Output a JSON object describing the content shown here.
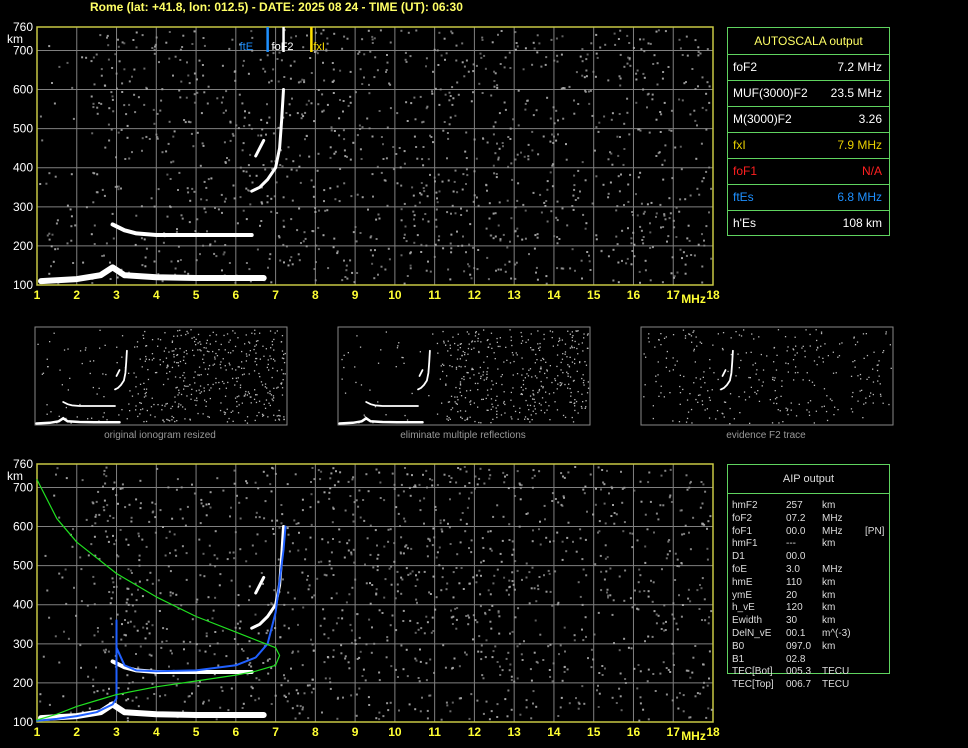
{
  "header": "Rome (lat: +41.8, lon: 012.5) - DATE: 2025 08 24 - TIME (UT): 06:30",
  "colors": {
    "grid": "#808080",
    "axis": "#c8c844",
    "trace": "#ffffff",
    "noise": "#a8a8a8",
    "green": "#20e020",
    "blue": "#2060ff",
    "foF2": "#ffffff",
    "fxI": "#ffe000",
    "ftEs": "#1e90ff",
    "na": "#ff2020"
  },
  "autoscala": {
    "title": "AUTOSCALA output",
    "rows": [
      {
        "label": "foF2",
        "value": "7.2 MHz",
        "color": "#ffffff"
      },
      {
        "label": "MUF(3000)F2",
        "value": "23.5 MHz",
        "color": "#ffffff"
      },
      {
        "label": "M(3000)F2",
        "value": "3.26",
        "color": "#ffffff"
      },
      {
        "label": "fxI",
        "value": "7.9 MHz",
        "color": "#e8d000"
      },
      {
        "label": "foF1",
        "value": "N/A",
        "color": "#ff2020"
      },
      {
        "label": "ftEs",
        "value": "6.8 MHz",
        "color": "#1e90ff"
      },
      {
        "label": "h'Es",
        "value": "108     km",
        "color": "#ffffff"
      }
    ]
  },
  "markers": {
    "ftEs": "ftE",
    "foF2": "foF2",
    "fxI": "fxI"
  },
  "thumb_captions": [
    "original ionogram resized",
    "eliminate multiple reflections",
    "evidence F2 trace"
  ],
  "aip": {
    "title": "AIP output",
    "rows": [
      [
        "hmF2",
        "257",
        "km",
        ""
      ],
      [
        "foF2",
        "07.2",
        "MHz",
        ""
      ],
      [
        "foF1",
        "00.0",
        "MHz",
        "[PN]"
      ],
      [
        "hmF1",
        "---",
        "km",
        ""
      ],
      [
        "D1",
        "00.0",
        "",
        ""
      ],
      [
        "foE",
        "3.0",
        "MHz",
        ""
      ],
      [
        "hmE",
        "110",
        "km",
        ""
      ],
      [
        "ymE",
        "20",
        "km",
        ""
      ],
      [
        "h_vE",
        "120",
        "km",
        ""
      ],
      [
        "Ewidth",
        "30",
        "km",
        ""
      ],
      [
        "DelN_vE",
        "00.1",
        "m^(-3)",
        ""
      ],
      [
        "B0",
        "097.0",
        "km",
        ""
      ],
      [
        "B1",
        "02.8",
        "",
        ""
      ],
      [
        "TEC[Bot]",
        "005.3",
        "TECU",
        ""
      ],
      [
        "TEC[Top]",
        "006.7",
        "TECU",
        ""
      ]
    ]
  },
  "chart_data": [
    {
      "type": "scatter",
      "title": "",
      "xlabel": "MHz",
      "ylabel": "km",
      "xlim": [
        1,
        18
      ],
      "ylim": [
        100,
        760
      ],
      "x_ticks": [
        1,
        2,
        3,
        4,
        5,
        6,
        7,
        8,
        9,
        10,
        11,
        12,
        13,
        14,
        15,
        16,
        17,
        18
      ],
      "y_ticks": [
        100,
        200,
        300,
        400,
        500,
        600,
        700,
        760
      ],
      "grid": true,
      "traces": [
        {
          "name": "E trace",
          "points": [
            [
              1.1,
              110
            ],
            [
              2,
              115
            ],
            [
              2.6,
              125
            ],
            [
              2.9,
              145
            ],
            [
              3.2,
              125
            ],
            [
              4,
              120
            ],
            [
              5,
              118
            ],
            [
              6,
              118
            ],
            [
              6.7,
              118
            ]
          ]
        },
        {
          "name": "F trace",
          "points": [
            [
              2.9,
              255
            ],
            [
              3.2,
              240
            ],
            [
              3.5,
              232
            ],
            [
              4,
              228
            ],
            [
              5,
              228
            ],
            [
              6,
              228
            ],
            [
              6.4,
              228
            ]
          ]
        },
        {
          "name": "F2 ordinary",
          "points": [
            [
              6.4,
              340
            ],
            [
              6.6,
              350
            ],
            [
              6.8,
              370
            ],
            [
              7.0,
              400
            ],
            [
              7.1,
              450
            ],
            [
              7.15,
              520
            ],
            [
              7.2,
              600
            ]
          ]
        },
        {
          "name": "multiple reflection",
          "points": [
            [
              6.5,
              430
            ],
            [
              6.7,
              470
            ]
          ]
        }
      ]
    },
    {
      "type": "line",
      "title": "",
      "xlabel": "MHz",
      "ylabel": "km",
      "xlim": [
        1,
        18
      ],
      "ylim": [
        100,
        760
      ],
      "x_ticks": [
        1,
        2,
        3,
        4,
        5,
        6,
        7,
        8,
        9,
        10,
        11,
        12,
        13,
        14,
        15,
        16,
        17,
        18
      ],
      "y_ticks": [
        100,
        200,
        300,
        400,
        500,
        600,
        700,
        760
      ],
      "grid": true,
      "series": [
        {
          "points": [
            [
              1,
              720
            ],
            [
              1.5,
              620
            ],
            [
              2,
              560
            ],
            [
              3,
              480
            ],
            [
              4,
              420
            ],
            [
              5,
              370
            ],
            [
              6,
              330
            ],
            [
              6.5,
              310
            ],
            [
              7,
              290
            ],
            [
              7.1,
              270
            ],
            [
              7,
              245
            ],
            [
              6.5,
              230
            ],
            [
              6,
              220
            ],
            [
              5,
              205
            ],
            [
              4,
              190
            ],
            [
              3,
              170
            ],
            [
              2.5,
              155
            ],
            [
              2,
              140
            ],
            [
              1.5,
              120
            ],
            [
              1,
              105
            ]
          ]
        },
        {
          "points": [
            [
              1,
              103
            ],
            [
              1.5,
              108
            ],
            [
              2,
              115
            ],
            [
              2.5,
              125
            ],
            [
              2.9,
              145
            ],
            [
              3,
              160
            ],
            [
              3,
              360
            ],
            [
              3,
              290
            ],
            [
              3.2,
              245
            ],
            [
              3.5,
              232
            ],
            [
              4,
              230
            ],
            [
              5,
              232
            ],
            [
              6,
              245
            ],
            [
              6.5,
              265
            ],
            [
              6.8,
              300
            ],
            [
              7.0,
              380
            ],
            [
              7.1,
              460
            ],
            [
              7.2,
              540
            ],
            [
              7.25,
              600
            ]
          ]
        }
      ]
    }
  ]
}
